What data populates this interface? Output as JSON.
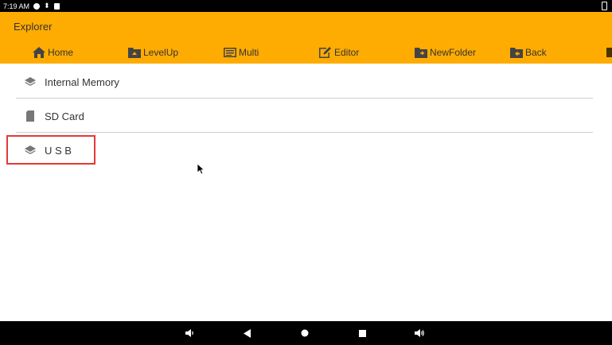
{
  "status_bar": {
    "time": "7:19 AM"
  },
  "app": {
    "title": "Explorer"
  },
  "toolbar": {
    "home": "Home",
    "levelup": "LevelUp",
    "multi": "Multi",
    "editor": "Editor",
    "newfolder": "NewFolder",
    "back": "Back"
  },
  "storage_list": [
    {
      "label": "Internal Memory",
      "icon": "layers-icon"
    },
    {
      "label": "SD Card",
      "icon": "sd-card-icon"
    },
    {
      "label": "U S B",
      "icon": "layers-icon"
    }
  ],
  "colors": {
    "app_bar": "#ffac02",
    "highlight": "#e53935"
  },
  "nav_bar": [
    "volume-down-icon",
    "back-triangle-icon",
    "home-circle-icon",
    "recents-square-icon",
    "volume-up-icon"
  ]
}
